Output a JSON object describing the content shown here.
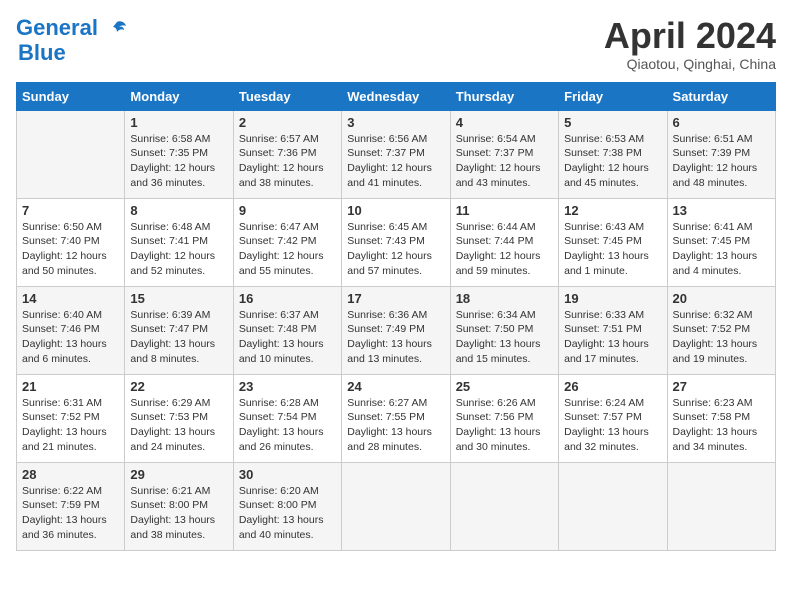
{
  "header": {
    "logo_line1": "General",
    "logo_line2": "Blue",
    "month_title": "April 2024",
    "location": "Qiaotou, Qinghai, China"
  },
  "days_of_week": [
    "Sunday",
    "Monday",
    "Tuesday",
    "Wednesday",
    "Thursday",
    "Friday",
    "Saturday"
  ],
  "weeks": [
    [
      {
        "day": "",
        "info": ""
      },
      {
        "day": "1",
        "info": "Sunrise: 6:58 AM\nSunset: 7:35 PM\nDaylight: 12 hours\nand 36 minutes."
      },
      {
        "day": "2",
        "info": "Sunrise: 6:57 AM\nSunset: 7:36 PM\nDaylight: 12 hours\nand 38 minutes."
      },
      {
        "day": "3",
        "info": "Sunrise: 6:56 AM\nSunset: 7:37 PM\nDaylight: 12 hours\nand 41 minutes."
      },
      {
        "day": "4",
        "info": "Sunrise: 6:54 AM\nSunset: 7:37 PM\nDaylight: 12 hours\nand 43 minutes."
      },
      {
        "day": "5",
        "info": "Sunrise: 6:53 AM\nSunset: 7:38 PM\nDaylight: 12 hours\nand 45 minutes."
      },
      {
        "day": "6",
        "info": "Sunrise: 6:51 AM\nSunset: 7:39 PM\nDaylight: 12 hours\nand 48 minutes."
      }
    ],
    [
      {
        "day": "7",
        "info": "Sunrise: 6:50 AM\nSunset: 7:40 PM\nDaylight: 12 hours\nand 50 minutes."
      },
      {
        "day": "8",
        "info": "Sunrise: 6:48 AM\nSunset: 7:41 PM\nDaylight: 12 hours\nand 52 minutes."
      },
      {
        "day": "9",
        "info": "Sunrise: 6:47 AM\nSunset: 7:42 PM\nDaylight: 12 hours\nand 55 minutes."
      },
      {
        "day": "10",
        "info": "Sunrise: 6:45 AM\nSunset: 7:43 PM\nDaylight: 12 hours\nand 57 minutes."
      },
      {
        "day": "11",
        "info": "Sunrise: 6:44 AM\nSunset: 7:44 PM\nDaylight: 12 hours\nand 59 minutes."
      },
      {
        "day": "12",
        "info": "Sunrise: 6:43 AM\nSunset: 7:45 PM\nDaylight: 13 hours\nand 1 minute."
      },
      {
        "day": "13",
        "info": "Sunrise: 6:41 AM\nSunset: 7:45 PM\nDaylight: 13 hours\nand 4 minutes."
      }
    ],
    [
      {
        "day": "14",
        "info": "Sunrise: 6:40 AM\nSunset: 7:46 PM\nDaylight: 13 hours\nand 6 minutes."
      },
      {
        "day": "15",
        "info": "Sunrise: 6:39 AM\nSunset: 7:47 PM\nDaylight: 13 hours\nand 8 minutes."
      },
      {
        "day": "16",
        "info": "Sunrise: 6:37 AM\nSunset: 7:48 PM\nDaylight: 13 hours\nand 10 minutes."
      },
      {
        "day": "17",
        "info": "Sunrise: 6:36 AM\nSunset: 7:49 PM\nDaylight: 13 hours\nand 13 minutes."
      },
      {
        "day": "18",
        "info": "Sunrise: 6:34 AM\nSunset: 7:50 PM\nDaylight: 13 hours\nand 15 minutes."
      },
      {
        "day": "19",
        "info": "Sunrise: 6:33 AM\nSunset: 7:51 PM\nDaylight: 13 hours\nand 17 minutes."
      },
      {
        "day": "20",
        "info": "Sunrise: 6:32 AM\nSunset: 7:52 PM\nDaylight: 13 hours\nand 19 minutes."
      }
    ],
    [
      {
        "day": "21",
        "info": "Sunrise: 6:31 AM\nSunset: 7:52 PM\nDaylight: 13 hours\nand 21 minutes."
      },
      {
        "day": "22",
        "info": "Sunrise: 6:29 AM\nSunset: 7:53 PM\nDaylight: 13 hours\nand 24 minutes."
      },
      {
        "day": "23",
        "info": "Sunrise: 6:28 AM\nSunset: 7:54 PM\nDaylight: 13 hours\nand 26 minutes."
      },
      {
        "day": "24",
        "info": "Sunrise: 6:27 AM\nSunset: 7:55 PM\nDaylight: 13 hours\nand 28 minutes."
      },
      {
        "day": "25",
        "info": "Sunrise: 6:26 AM\nSunset: 7:56 PM\nDaylight: 13 hours\nand 30 minutes."
      },
      {
        "day": "26",
        "info": "Sunrise: 6:24 AM\nSunset: 7:57 PM\nDaylight: 13 hours\nand 32 minutes."
      },
      {
        "day": "27",
        "info": "Sunrise: 6:23 AM\nSunset: 7:58 PM\nDaylight: 13 hours\nand 34 minutes."
      }
    ],
    [
      {
        "day": "28",
        "info": "Sunrise: 6:22 AM\nSunset: 7:59 PM\nDaylight: 13 hours\nand 36 minutes."
      },
      {
        "day": "29",
        "info": "Sunrise: 6:21 AM\nSunset: 8:00 PM\nDaylight: 13 hours\nand 38 minutes."
      },
      {
        "day": "30",
        "info": "Sunrise: 6:20 AM\nSunset: 8:00 PM\nDaylight: 13 hours\nand 40 minutes."
      },
      {
        "day": "",
        "info": ""
      },
      {
        "day": "",
        "info": ""
      },
      {
        "day": "",
        "info": ""
      },
      {
        "day": "",
        "info": ""
      }
    ]
  ]
}
